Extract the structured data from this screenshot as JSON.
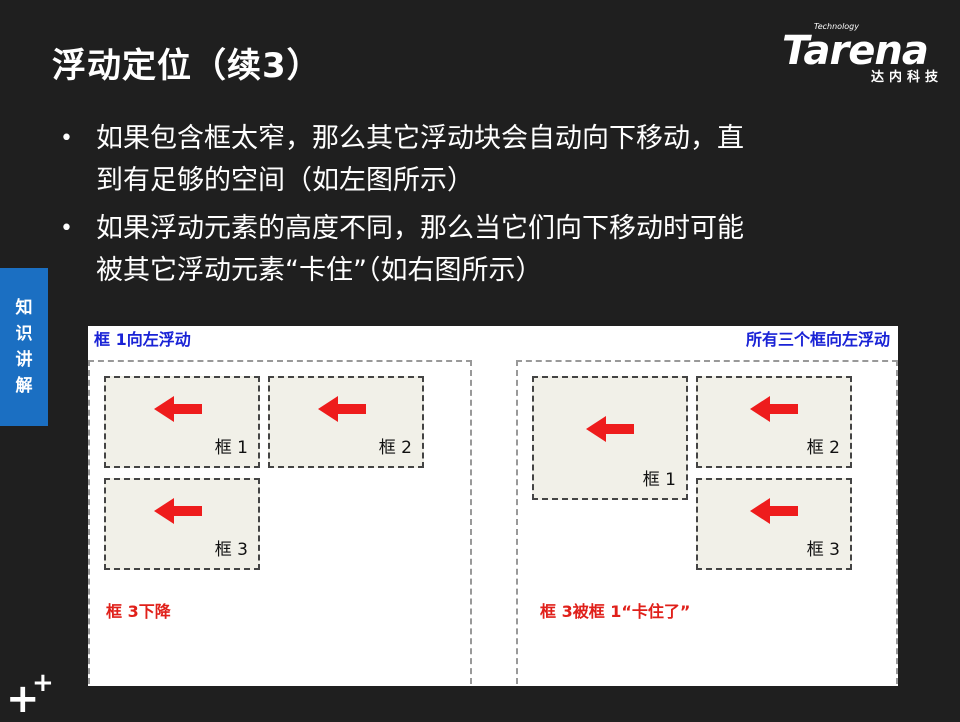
{
  "title": "浮动定位（续3）",
  "logo": {
    "small": "Technology",
    "main": "Tarena",
    "sub": "达内科技"
  },
  "side_tab": {
    "chars": [
      "知",
      "识",
      "讲",
      "解"
    ]
  },
  "bullets": [
    {
      "line1": "如果包含框太窄，那么其它浮动块会自动向下移动，直",
      "line2": "到有足够的空间（如左图所示）"
    },
    {
      "line1": "如果浮动元素的高度不同，那么当它们向下移动时可能",
      "line2": "被其它浮动元素“卡住”（如右图所示）"
    }
  ],
  "bullet_glyph": "•",
  "figure": {
    "left_caption": "框 1向左浮动",
    "right_caption": "所有三个框向左浮动",
    "left_boxes": [
      "框 1",
      "框 2",
      "框 3"
    ],
    "right_boxes": [
      "框 1",
      "框 2",
      "框 3"
    ],
    "left_note": "框 3下降",
    "right_note": "框 3被框 1“卡住了”"
  },
  "colors": {
    "arrow": "#ee1c1c",
    "tab": "#1b6fc2",
    "caption": "#1a23d6",
    "note": "#e0201a"
  },
  "icons": {
    "arrow": "left-arrow-icon",
    "corner": "plus-icon"
  },
  "corner_glyphs": {
    "big": "+",
    "small": "+"
  }
}
